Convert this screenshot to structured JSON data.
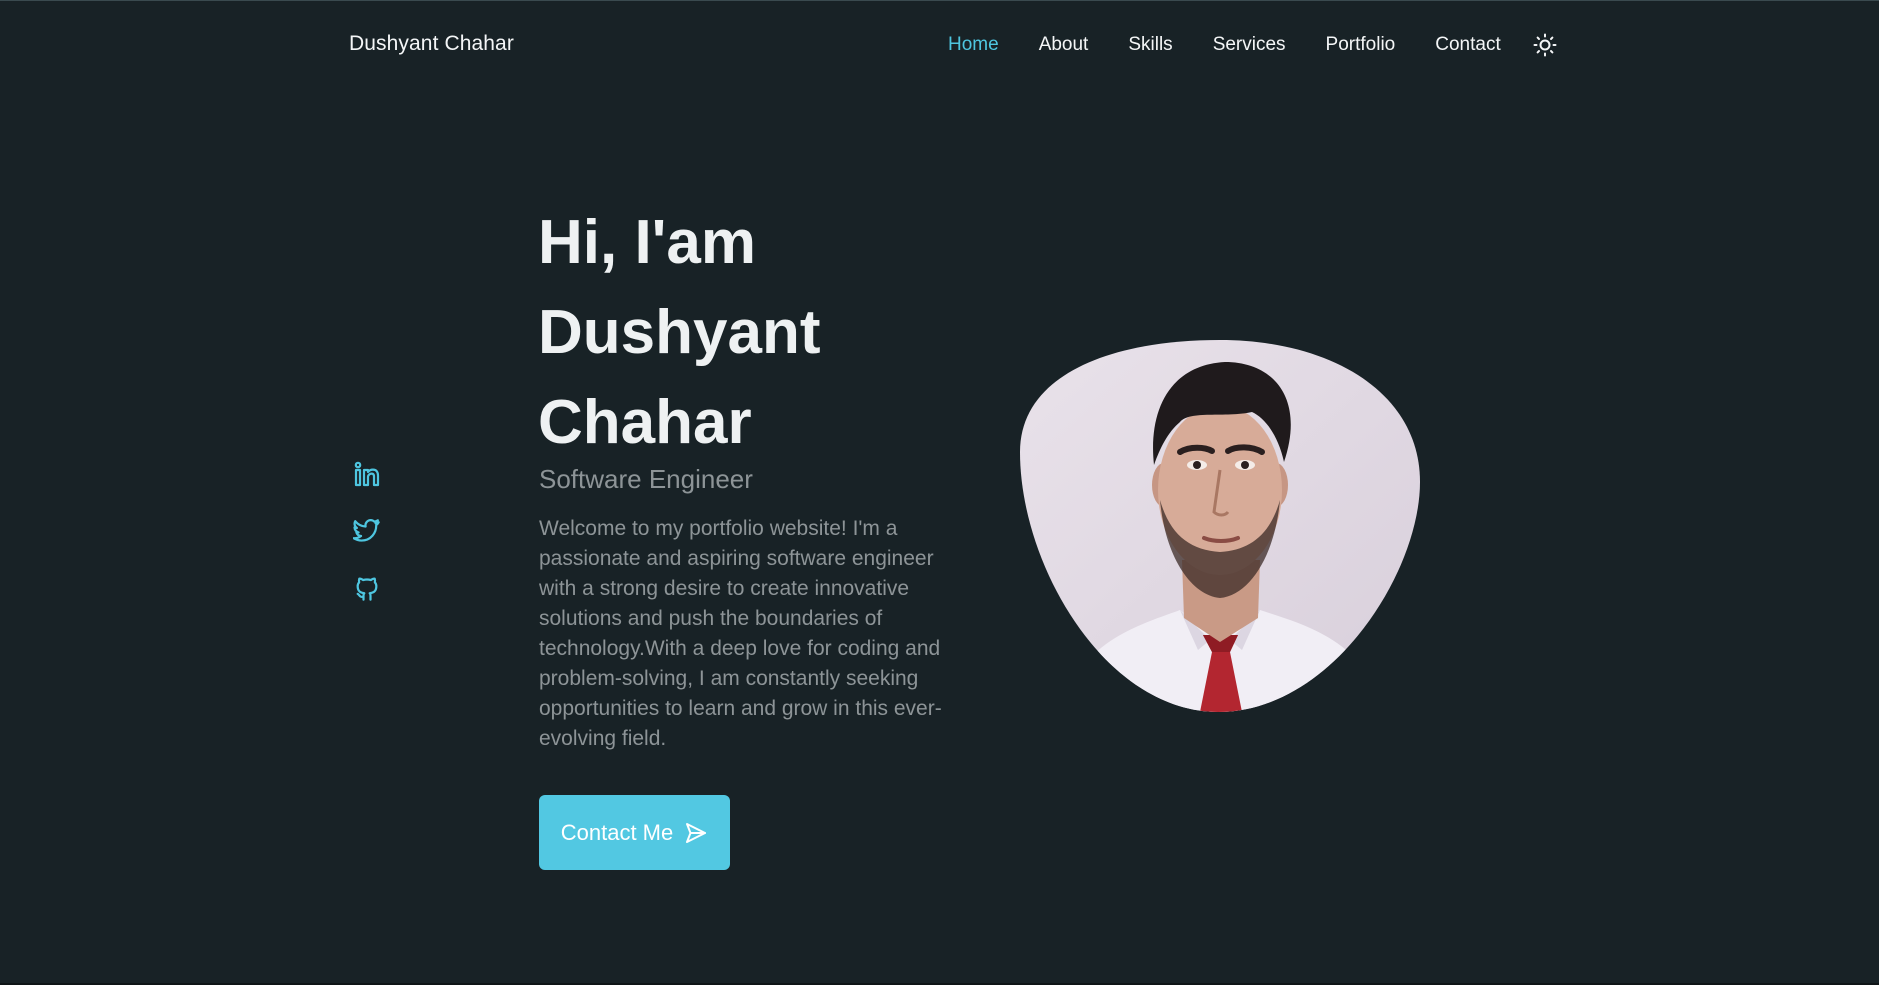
{
  "header": {
    "brand": "Dushyant Chahar",
    "nav": [
      "Home",
      "About",
      "Skills",
      "Services",
      "Portfolio",
      "Contact"
    ],
    "active": "Home",
    "theme_icon": "sun-icon"
  },
  "social": {
    "icons": [
      "linkedin-icon",
      "twitter-icon",
      "github-icon"
    ]
  },
  "hero": {
    "title_line1": "Hi, I'am",
    "title_line2": "Dushyant",
    "title_line3": "Chahar",
    "subtitle": "Software Engineer",
    "description": "Welcome to my portfolio website! I'm a passionate and aspiring software engineer with a strong desire to create innovative solutions and push the boundaries of technology.With a deep love for coding and problem-solving, I am constantly seeking opportunities to learn and grow in this ever-evolving field.",
    "button_label": "Contact Me",
    "button_icon": "send-icon"
  },
  "colors": {
    "background": "#182226",
    "accent": "#52c8e2",
    "muted_text": "#8d9497",
    "heading_text": "#eef1f2"
  }
}
